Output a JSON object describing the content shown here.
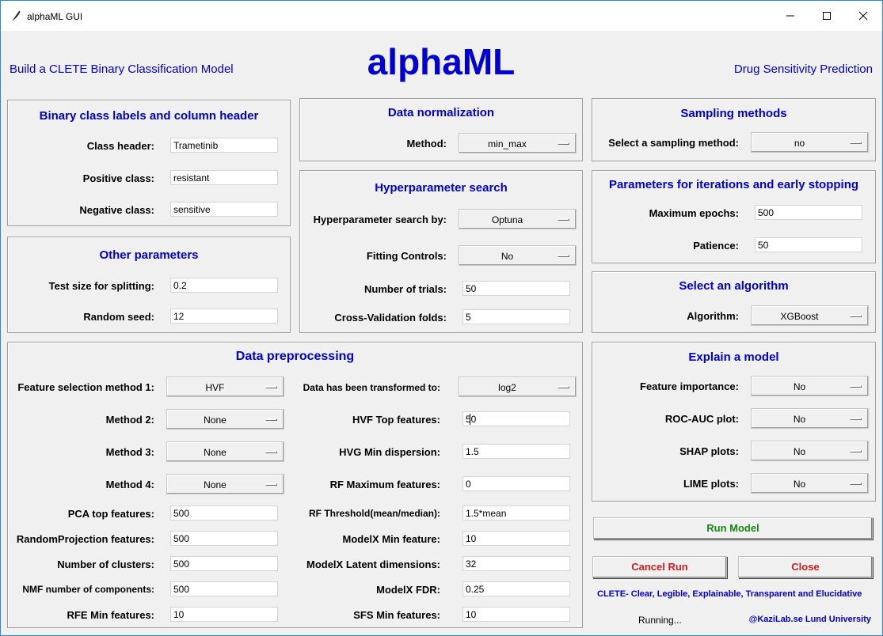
{
  "window": {
    "title": "alphaML GUI",
    "icon": "feather-icon",
    "controls": [
      "minimize-icon",
      "maximize-icon",
      "close-icon"
    ]
  },
  "header": {
    "left_text": "Build a CLETE Binary Classification Model",
    "app_name": "alphaML",
    "right_text": "Drug Sensitivity Prediction"
  },
  "binary": {
    "title": "Binary class labels and column header",
    "class_header_label": "Class header:",
    "class_header_value": "Trametinib",
    "positive_label": "Positive class:",
    "positive_value": "resistant",
    "negative_label": "Negative class:",
    "negative_value": "sensitive"
  },
  "other": {
    "title": "Other parameters",
    "test_size_label": "Test size for splitting:",
    "test_size_value": "0.2",
    "seed_label": "Random seed:",
    "seed_value": "12"
  },
  "normalization": {
    "title": "Data normalization",
    "method_label": "Method:",
    "method_value": "min_max"
  },
  "hyper": {
    "title": "Hyperparameter search",
    "search_label": "Hyperparameter search by:",
    "search_value": "Optuna",
    "fitting_label": "Fitting Controls:",
    "fitting_value": "No",
    "trials_label": "Number of trials:",
    "trials_value": "50",
    "cv_label": "Cross-Validation folds:",
    "cv_value": "5"
  },
  "sampling": {
    "title": "Sampling methods",
    "select_label": "Select a sampling method:",
    "select_value": "no"
  },
  "iter": {
    "title": "Parameters for iterations and early stopping",
    "epochs_label": "Maximum epochs:",
    "epochs_value": "500",
    "patience_label": "Patience:",
    "patience_value": "50"
  },
  "algo": {
    "title": "Select an algorithm",
    "label": "Algorithm:",
    "value": "XGBoost"
  },
  "prep": {
    "title": "Data preprocessing",
    "fs1_label": "Feature selection method 1:",
    "fs1_value": "HVF",
    "m2_label": "Method 2:",
    "m2_value": "None",
    "m3_label": "Method 3:",
    "m3_value": "None",
    "m4_label": "Method 4:",
    "m4_value": "None",
    "pca_label": "PCA top features:",
    "pca_value": "500",
    "rp_label": "RandomProjection features:",
    "rp_value": "500",
    "clusters_label": "Number of clusters:",
    "clusters_value": "500",
    "nmf_label": "NMF number of components:",
    "nmf_value": "500",
    "rfe_label": "RFE Min features:",
    "rfe_value": "10",
    "transformed_label": "Data has been transformed to:",
    "transformed_value": "log2",
    "hvf_label": "HVF Top features:",
    "hvf_value": "50",
    "hvg_label": "HVG Min dispersion:",
    "hvg_value": "1.5",
    "rfmax_label": "RF Maximum features:",
    "rfmax_value": "0",
    "rfthr_label": "RF Threshold(mean/median):",
    "rfthr_value": "1.5*mean",
    "mxmin_label": "ModelX Min feature:",
    "mxmin_value": "10",
    "mxlat_label": "ModelX Latent dimensions:",
    "mxlat_value": "32",
    "mxfdr_label": "ModelX FDR:",
    "mxfdr_value": "0.25",
    "sfs_label": "SFS Min features:",
    "sfs_value": "10"
  },
  "explain": {
    "title": "Explain a model",
    "fi_label": "Feature importance:",
    "fi_value": "No",
    "roc_label": "ROC-AUC plot:",
    "roc_value": "No",
    "shap_label": "SHAP plots:",
    "shap_value": "No",
    "lime_label": "LIME plots:",
    "lime_value": "No"
  },
  "actions": {
    "run_label": "Run Model",
    "cancel_label": "Cancel Run",
    "close_label": "Close"
  },
  "footer": {
    "clete_text": "CLETE- Clear, Legible, Explainable, Transparent and Elucidative",
    "status_text": "Running...",
    "credit_text": "@KaziLab.se Lund University"
  },
  "colors": {
    "title_blue": "#0000d2",
    "run_green": "#158815",
    "cancel_red": "#c81e1e",
    "window_bg": "#f0f0f0"
  }
}
